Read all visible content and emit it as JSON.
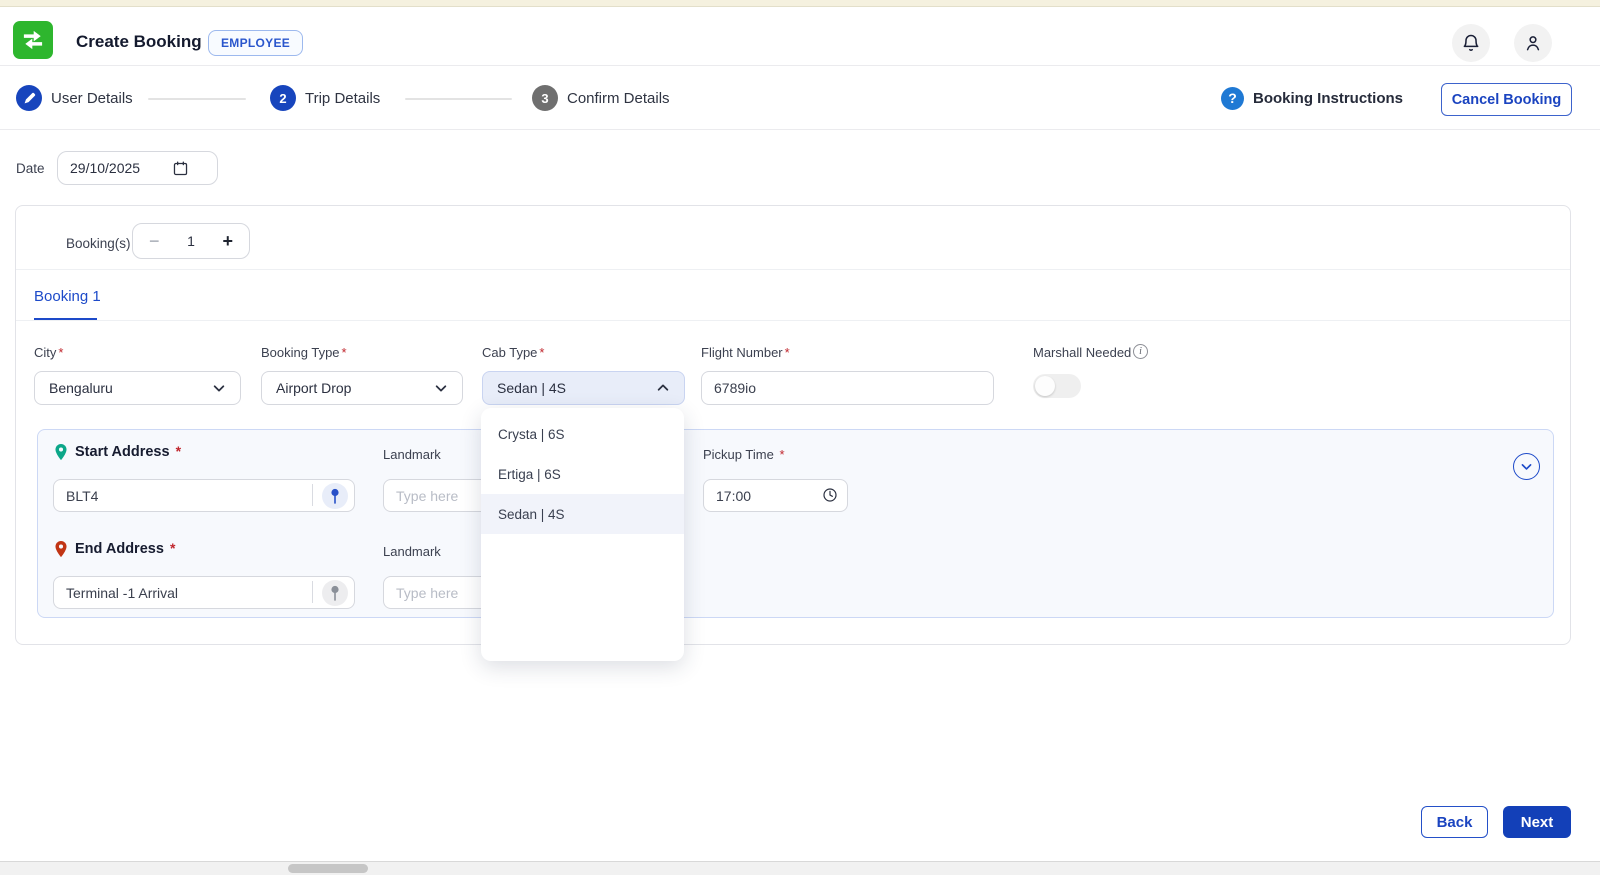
{
  "app": {
    "title": "Create Booking",
    "badge": "EMPLOYEE"
  },
  "header_icons": {
    "notifications": "bell-icon",
    "profile": "person-icon"
  },
  "stepper": {
    "steps": [
      {
        "label": "User Details",
        "state": "completed",
        "icon": "pencil-icon"
      },
      {
        "number": "2",
        "label": "Trip Details",
        "state": "active"
      },
      {
        "number": "3",
        "label": "Confirm Details",
        "state": "pending"
      }
    ],
    "instructions_label": "Booking Instructions",
    "cancel_label": "Cancel Booking"
  },
  "date": {
    "label": "Date",
    "value": "29/10/2025"
  },
  "counter": {
    "label": "Booking(s)",
    "minus": "−",
    "value": "1",
    "plus": "+"
  },
  "tab": {
    "label": "Booking 1"
  },
  "required_mark": "*",
  "form": {
    "city": {
      "label": "City",
      "value": "Bengaluru"
    },
    "booking_type": {
      "label": "Booking Type",
      "value": "Airport Drop"
    },
    "cab_type": {
      "label": "Cab Type",
      "value": "Sedan | 4S",
      "open": true,
      "options": [
        "Crysta | 6S",
        "Ertiga | 6S",
        "Sedan | 4S"
      ],
      "selected": "Sedan | 4S"
    },
    "flight_number": {
      "label": "Flight Number",
      "value": "6789io"
    },
    "marshall": {
      "label": "Marshall Needed",
      "enabled": "off"
    }
  },
  "addresses": {
    "start": {
      "label": "Start Address",
      "value": "BLT4"
    },
    "start_landmark": {
      "label": "Landmark",
      "placeholder": "Type here"
    },
    "pickup_time": {
      "label": "Pickup Time",
      "value": "17:00"
    },
    "end": {
      "label": "End Address",
      "value": "Terminal -1 Arrival"
    },
    "end_landmark": {
      "label": "Landmark",
      "placeholder": "Type here"
    }
  },
  "footer": {
    "back_label": "Back",
    "next_label": "Next"
  },
  "colors": {
    "primary_blue": "#1745bd",
    "link_blue": "#1d4ac9",
    "logo_green": "#2eb62e",
    "start_pin_teal": "#0ca789",
    "end_pin_red": "#c0392b",
    "pending_gray": "#6f6f6f",
    "addr_card_bg": "#f7f9fd"
  }
}
